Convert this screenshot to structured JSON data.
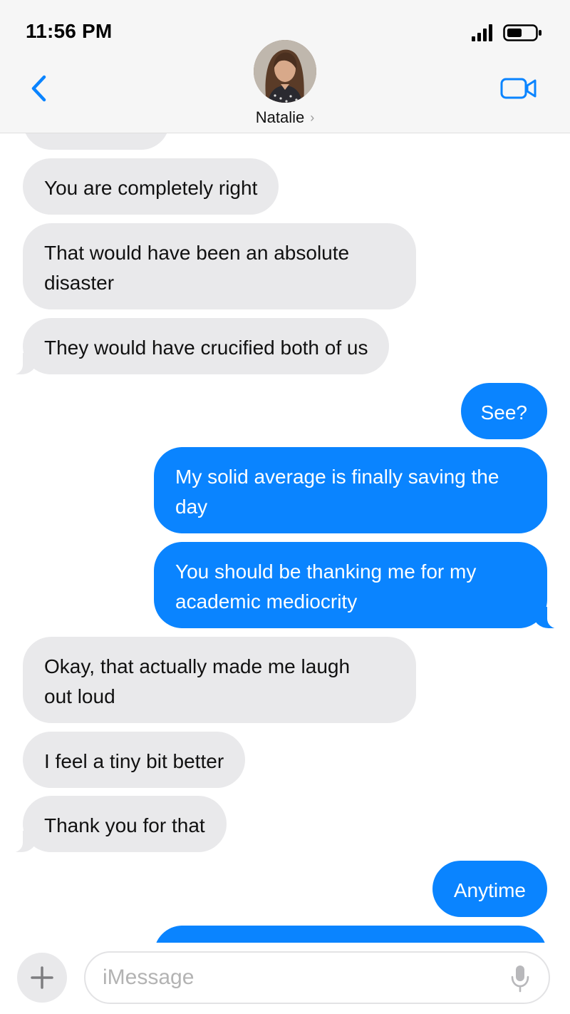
{
  "status_bar": {
    "time": "11:56 PM"
  },
  "header": {
    "contact_name": "Natalie",
    "contact_chevron": "›",
    "icons": [
      "chevron-left-icon",
      "video-camera-icon",
      "contact-chevron-icon"
    ]
  },
  "messages": [
    {
      "text": "You are completely right",
      "from": "them"
    },
    {
      "text": "That would have been an absolute\ndisaster",
      "from": "them"
    },
    {
      "text": "They would have crucified both of us",
      "from": "them"
    },
    {
      "text": "See?",
      "from": "me"
    },
    {
      "text": "My solid average is finally saving the\nday",
      "from": "me"
    },
    {
      "text": "You should be thanking me for my\nacademic mediocrity",
      "from": "me"
    },
    {
      "text": "Okay, that actually made me laugh\nout loud",
      "from": "them"
    },
    {
      "text": "I feel a tiny bit better",
      "from": "them"
    },
    {
      "text": "Thank you for that",
      "from": "them"
    },
    {
      "text": "Anytime",
      "from": "me"
    }
  ],
  "composer": {
    "placeholder": "iMessage",
    "value": "",
    "plus_label": "+",
    "icons": [
      "plus-icon",
      "microphone-icon"
    ]
  },
  "colors": {
    "outgoing_bubble": "#0a84ff",
    "incoming_bubble": "#e9e9eb",
    "accent": "#0a84ff",
    "header_background": "#f6f6f6"
  }
}
